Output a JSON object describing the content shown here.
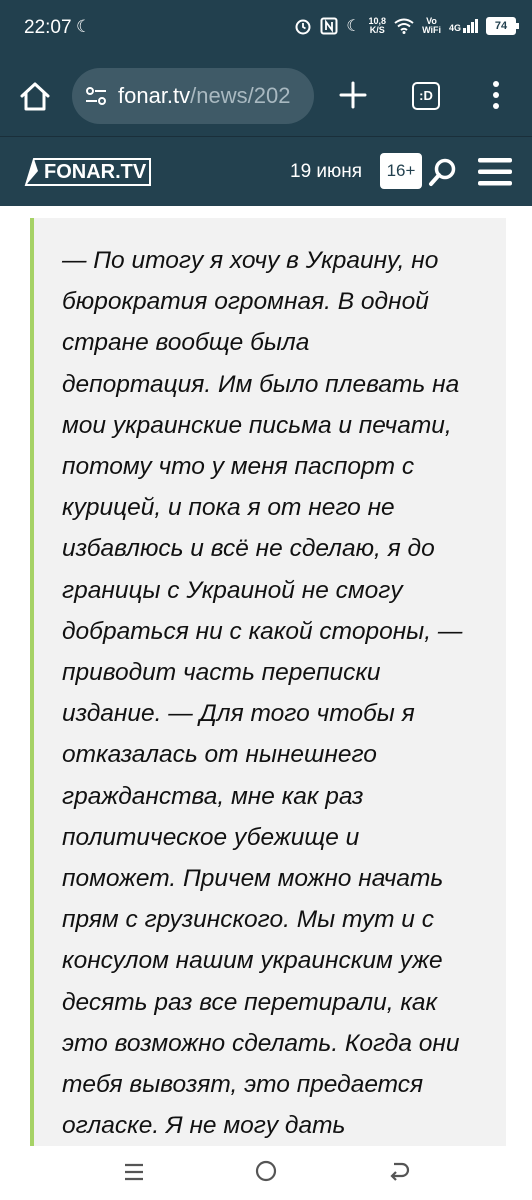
{
  "status_bar": {
    "time": "22:07",
    "net_speed_value": "10,8",
    "net_speed_unit": "K/S",
    "vo_label": "Vo",
    "wifi_label": "WiFi",
    "network_type": "4G",
    "battery": "74"
  },
  "browser": {
    "url_host": "fonar.tv",
    "url_path": "/news/202",
    "tabs_label": ":D"
  },
  "site": {
    "logo": "FONAR.TV",
    "date": "19 июня",
    "age_rating": "16+"
  },
  "article": {
    "quote_lines": [
      "— По итогу я хочу в Украину, но",
      "бюрократия огромная. В одной",
      "стране вообще была",
      "депортация. Им было плевать на",
      "мои украинские письма и печати,",
      "потому что у меня паспорт с",
      "курицей, и пока я от него не",
      "избавлюсь и всё не сделаю, я до",
      "границы с Украиной не смогу",
      "добраться ни с какой стороны, —",
      "приводит часть переписки",
      "издание. — Для того чтобы я",
      "отказалась от нынешнего",
      "гражданства, мне как раз",
      "политическое убежище и",
      "поможет. Причем можно начать",
      "прям с грузинского. Мы тут и с",
      "консулом нашим украинским уже",
      "десять раз все перетирали, как",
      "это возможно сделать. Когда они",
      "тебя вывозят, это предается",
      "огласке. Я не могу дать"
    ]
  },
  "colors": {
    "header_bg": "#22404e",
    "url_box_bg": "#3f5a67",
    "quote_bg": "#f2f2f2",
    "quote_border": "#a6d266"
  },
  "icons": {
    "home": "home-icon",
    "site_settings": "tune-icon",
    "new_tab": "plus-icon",
    "menu": "more-vert-icon",
    "search": "search-icon",
    "site_menu": "hamburger-icon",
    "nav_recent": "recent-apps-icon",
    "nav_home": "nav-home-icon",
    "nav_back": "back-icon"
  }
}
